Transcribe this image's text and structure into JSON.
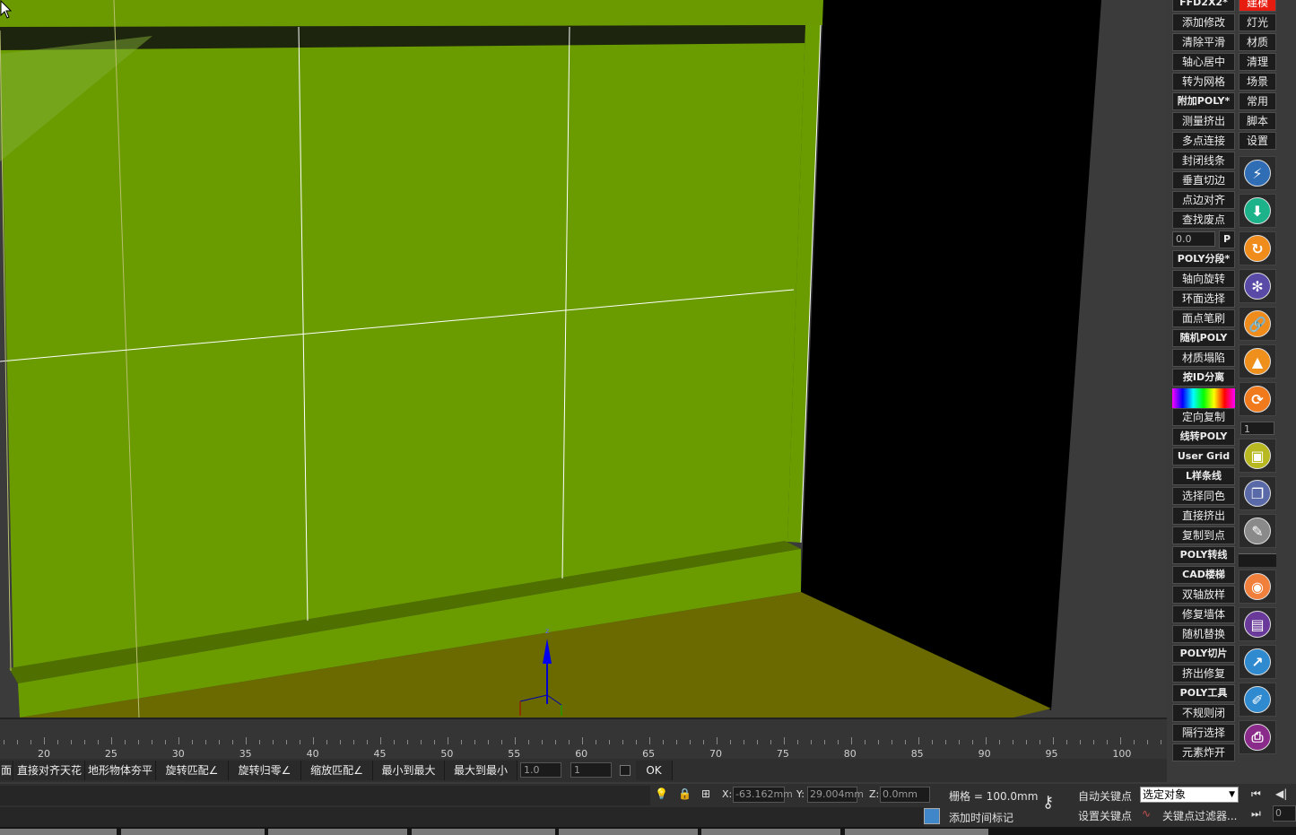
{
  "viewport": {
    "gizmo_label": "z"
  },
  "toolbar_left": [
    "FFD2X2*",
    "添加修改",
    "清除平滑",
    "轴心居中",
    "转为网格",
    "附加POLY*",
    "测量挤出",
    "多点连接",
    "封闭线条",
    "垂直切边",
    "点边对齐",
    "查找废点",
    "POLY分段*",
    "轴向旋转",
    "环面选择",
    "面点笔刷",
    "随机POLY",
    "材质塌陷",
    "按ID分离",
    "定向复制",
    "线转POLY",
    "User Grid",
    "L样条线",
    "选择同色",
    "直接挤出",
    "复制到点",
    "POLY转线",
    "CAD楼梯",
    "双轴放样",
    "修复墙体",
    "随机替换",
    "POLY切片",
    "挤出修复",
    "POLY工具",
    "不规则闭",
    "隔行选择",
    "元素炸开"
  ],
  "toolbar_left_spinner": {
    "value": "0.0",
    "button": "P"
  },
  "toolbar_right": [
    "建模",
    "灯光",
    "材质",
    "清理",
    "场景",
    "常用",
    "脚本",
    "设置"
  ],
  "toolbar_right_active": "建模",
  "icon_buttons": [
    {
      "name": "lightning-icon",
      "color": "#2f6db5",
      "glyph": "⚡"
    },
    {
      "name": "download-icon",
      "color": "#1db38a",
      "glyph": "⬇"
    },
    {
      "name": "refresh-icon",
      "color": "#f08c1c",
      "glyph": "↻"
    },
    {
      "name": "flower-icon",
      "color": "#5a4aa8",
      "glyph": "✻"
    },
    {
      "name": "link-icon",
      "color": "#f08c1c",
      "glyph": "🔗"
    },
    {
      "name": "chart-icon",
      "color": "#f0901c",
      "glyph": "▲"
    },
    {
      "name": "cycle-icon",
      "color": "#f07a1c",
      "glyph": "⟳"
    },
    {
      "name": "image-icon",
      "color": "#b8b820",
      "glyph": "▣"
    },
    {
      "name": "copy-icon",
      "color": "#5a6aa8",
      "glyph": "❐"
    },
    {
      "name": "eraser-icon",
      "color": "#8a8a8a",
      "glyph": "✎"
    },
    {
      "name": "camera-icon",
      "color": "#f0803c",
      "glyph": "◉"
    },
    {
      "name": "document-icon",
      "color": "#6a3a9a",
      "glyph": "▤"
    },
    {
      "name": "path-icon",
      "color": "#2f8ad0",
      "glyph": "↗"
    },
    {
      "name": "ruler-icon",
      "color": "#2f8ad0",
      "glyph": "✐"
    },
    {
      "name": "printer-icon",
      "color": "#8a2a8a",
      "glyph": "⎙"
    }
  ],
  "icon_spinner_value": "1",
  "timeline": {
    "ticks": [
      "20",
      "25",
      "30",
      "35",
      "40",
      "45",
      "50",
      "55",
      "60",
      "65",
      "70",
      "75",
      "80",
      "85",
      "90",
      "95",
      "100"
    ]
  },
  "scriptbar": {
    "buttons": [
      "直接对齐天花",
      "地形物体夯平",
      "旋转匹配∠",
      "旋转归零∠",
      "缩放匹配∠",
      "最小到最大",
      "最大到最小"
    ],
    "field1": "1.0",
    "field2": "1",
    "ok": "OK",
    "leading_char": "面"
  },
  "status": {
    "x_label": "X:",
    "x_value": "-63.162mm",
    "y_label": "Y:",
    "y_value": "29.004mm",
    "z_label": "Z:",
    "z_value": "0.0mm",
    "grid": "栅格 = 100.0mm",
    "add_time_tag": "添加时间标记",
    "auto_key": "自动关键点",
    "set_key": "设置关键点",
    "selection": "选定对象",
    "key_filters": "关键点过滤器...",
    "frame_value": "0"
  }
}
